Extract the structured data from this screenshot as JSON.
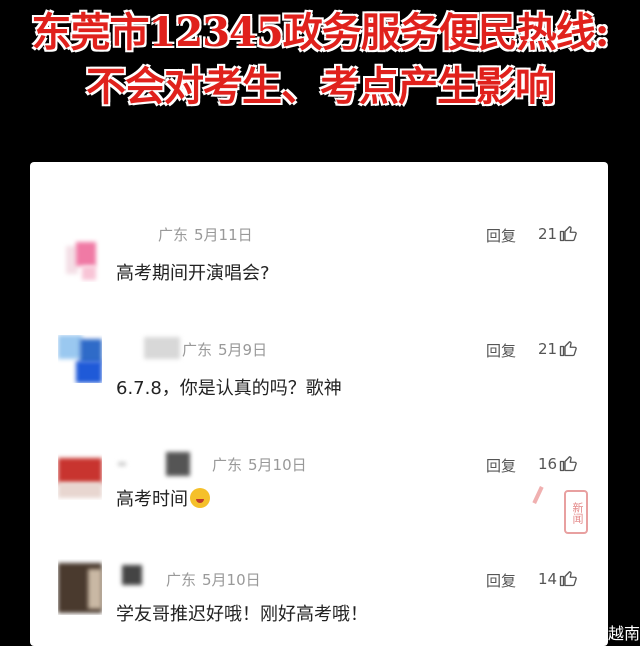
{
  "headline": {
    "line1": "东莞市12345政务服务便民热线:",
    "line2": "不会对考生、考点产生影响"
  },
  "comments": [
    {
      "region": "广东",
      "date": "5月11日",
      "text": "高考期间开演唱会?",
      "reply": "回复",
      "likes": "21"
    },
    {
      "region": "广东",
      "date": "5月9日",
      "text": "6.7.8，你是认真的吗？歌神",
      "reply": "回复",
      "likes": "21"
    },
    {
      "region": "广东",
      "date": "5月10日",
      "text": "高考时间",
      "reply": "回复",
      "likes": "16"
    },
    {
      "region": "广东",
      "date": "5月10日",
      "text": "学友哥推迟好哦！刚好高考哦！",
      "reply": "回复",
      "likes": "14"
    }
  ],
  "watermark": {
    "news": "新闻"
  },
  "corner_text": "越南",
  "colors": {
    "headline": "#e0211c",
    "page_bg": "#000000",
    "card_bg": "#ffffff"
  },
  "icons": [
    "thumbs-up-icon",
    "laughing-emoji-icon"
  ]
}
